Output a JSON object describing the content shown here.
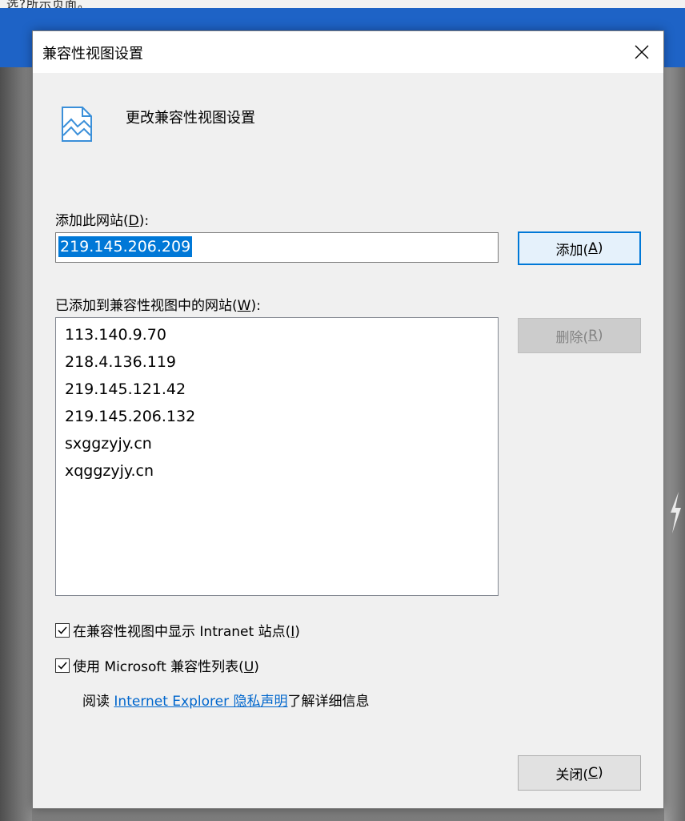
{
  "background": {
    "hint_text": "选?所示页面。"
  },
  "dialog": {
    "title": "兼容性视图设置",
    "header_text": "更改兼容性视图设置",
    "add_site": {
      "label": "添加此网站(",
      "mnemonic": "D",
      "label_suffix": "):",
      "input_value": "219.145.206.209"
    },
    "add_button": {
      "label": "添加(",
      "mnemonic": "A",
      "suffix": ")"
    },
    "list": {
      "label": "已添加到兼容性视图中的网站(",
      "mnemonic": "W",
      "label_suffix": "):",
      "items": [
        "113.140.9.70",
        "218.4.136.119",
        "219.145.121.42",
        "219.145.206.132",
        "sxggzyjy.cn",
        "xqggzyjy.cn"
      ]
    },
    "remove_button": {
      "label": "删除(",
      "mnemonic": "R",
      "suffix": ")"
    },
    "checkbox_intranet": {
      "checked": true,
      "label": "在兼容性视图中显示 Intranet 站点(",
      "mnemonic": "I",
      "suffix": ")"
    },
    "checkbox_microsoft_list": {
      "checked": true,
      "label": "使用 Microsoft 兼容性列表(",
      "mnemonic": "U",
      "suffix": ")"
    },
    "info": {
      "prefix": "阅读 ",
      "link_text": "Internet Explorer 隐私声明",
      "suffix": "了解详细信息"
    },
    "close_button": {
      "label": "关闭(",
      "mnemonic": "C",
      "suffix": ")"
    }
  },
  "colors": {
    "accent": "#0078d7",
    "link": "#0066cc",
    "background_blue": "#1e63c6"
  },
  "icons": {
    "title_close": "close-icon",
    "header": "compatibility-view-icon",
    "check": "checkmark-icon"
  }
}
